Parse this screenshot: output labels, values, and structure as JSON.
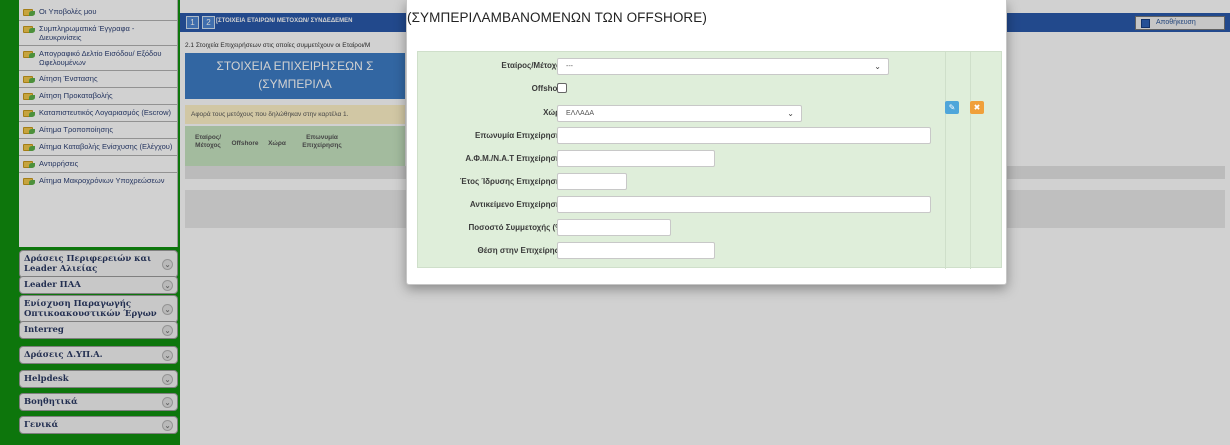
{
  "sidebar": {
    "items": [
      {
        "label": "Οι Υποβολές μου"
      },
      {
        "label": "Συμπληρωματικά Έγγραφα - Διευκρινίσεις"
      },
      {
        "label": "Απογραφικό Δελτίο Εισόδου/ Εξόδου Ωφελουμένων"
      },
      {
        "label": "Αίτηση Ένστασης"
      },
      {
        "label": "Αίτηση Προκαταβολής"
      },
      {
        "label": "Καταπιστευτικός Λογαριασμός (Escrow)"
      },
      {
        "label": "Αίτημα Τροποποίησης"
      },
      {
        "label": "Αίτημα Καταβολής Ενίσχυσης (Ελέγχου)"
      },
      {
        "label": "Αντιρρήσεις"
      },
      {
        "label": "Αίτημα Μακροχρόνιων Υποχρεώσεων"
      }
    ],
    "categories": [
      {
        "label": "Δράσεις Περιφερειών και Leader Αλιείας"
      },
      {
        "label": "Leader ΠΑΑ"
      },
      {
        "label": "Ενίσχυση Παραγωγής Οπτικοακουστικών Έργων"
      },
      {
        "label": "Interreg"
      },
      {
        "label": "Δράσεις Δ.ΥΠ.Α."
      },
      {
        "label": "Helpdesk"
      },
      {
        "label": "Βοηθητικά"
      },
      {
        "label": "Γενικά"
      }
    ]
  },
  "main": {
    "steps": [
      "1",
      "2"
    ],
    "step_title": "[ΣΤΟΙΧΕΙΑ ΕΤΑΙΡΩΝ/ ΜΕΤΟΧΩΝ/ ΣΥΝΔΕΔΕΜΕΝ",
    "save_label": "Αποθήκευση",
    "subtitle": "2.1 Στοιχεία Επιχειρήσεων στις οποίες συμμετέχουν οι Εταίροι/Μ",
    "header_line1": "ΣΤΟΙΧΕΙΑ ΕΠΙΧΕΙΡΗΣΕΩΝ Σ",
    "header_line2": "(ΣΥΜΠΕΡΙΛΑ",
    "note": "Αφορά τους μετόχους που δηλώθηκαν στην καρτέλα 1.",
    "table_headers": [
      "Εταίρος/ Μέτοχος",
      "Offshore",
      "Χώρα",
      "Επωνυμία Επιχείρησης"
    ]
  },
  "modal": {
    "title": "(ΣΥΜΠΕΡΙΛΑΜΒΑΝΟΜΕΝΩΝ ΤΩΝ OFFSHORE)",
    "fields": {
      "partner_label": "Εταίρος/Μέτοχος",
      "partner_value": "---",
      "offshore_label": "Offshore",
      "country_label": "Χώρα",
      "country_value": "ΕΛΛΑΔΑ",
      "company_name_label": "Επωνυμία Επιχείρησης",
      "vat_label": "Α.Φ.Μ./Ν.Α.Τ Επιχείρησης",
      "year_label": "Έτος Ίδρυσης Επιχείρησης",
      "object_label": "Αντικείμενο Επιχείρησης",
      "share_label": "Ποσοστό Συμμετοχής (%)",
      "position_label": "Θέση στην Επιχείρηση"
    }
  },
  "colors": {
    "sidebar_green": "#11910f",
    "top_bar_blue": "#2a5aab",
    "form_green": "#dfeeda",
    "edit_blue": "#4fa6da",
    "delete_orange": "#f0a03a"
  }
}
